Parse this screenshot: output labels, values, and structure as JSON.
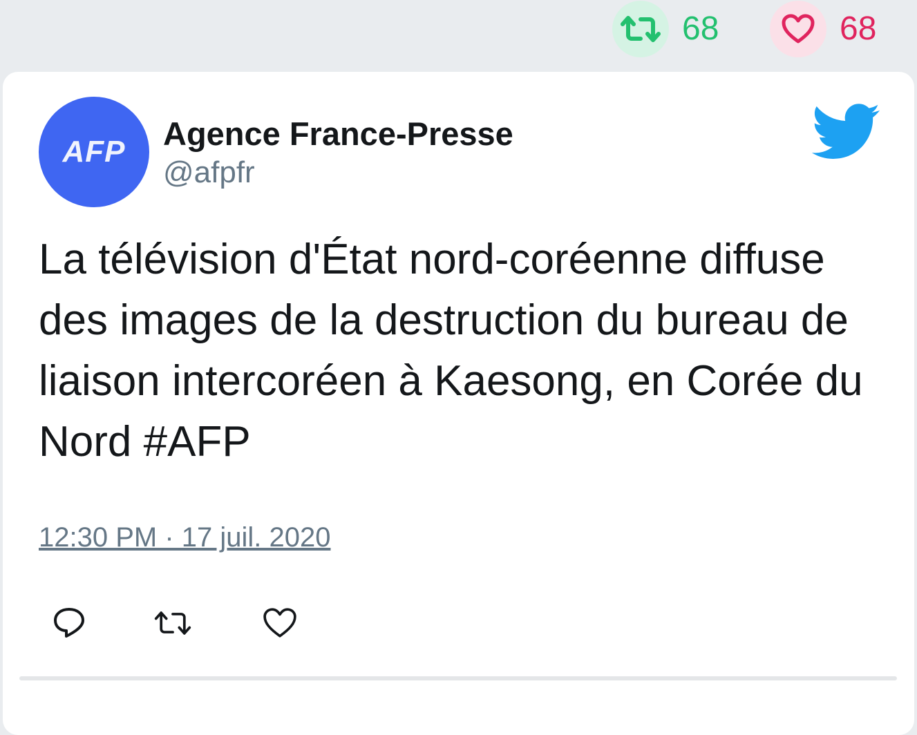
{
  "stats": {
    "retweet_count": "68",
    "like_count": "68"
  },
  "tweet": {
    "avatar_text": "AFP",
    "author_name": "Agence France-Presse",
    "author_handle": "@afpfr",
    "text": "La télévision d'État nord-coréenne diffuse des images de la destruction du bureau de liaison intercoréen à Kaesong, en Corée du Nord #AFP",
    "timestamp": "12:30 PM · 17 juil. 2020"
  },
  "icons": {
    "stats_retweet": "retweet-icon",
    "stats_like": "heart-icon",
    "brand": "twitter-bird-icon",
    "reply": "reply-icon",
    "retweet": "retweet-icon",
    "like": "heart-icon"
  },
  "colors": {
    "retweet_green": "#23c06f",
    "like_red": "#e0245e",
    "twitter_blue": "#1da1f2",
    "avatar_blue": "#3f66f2"
  }
}
